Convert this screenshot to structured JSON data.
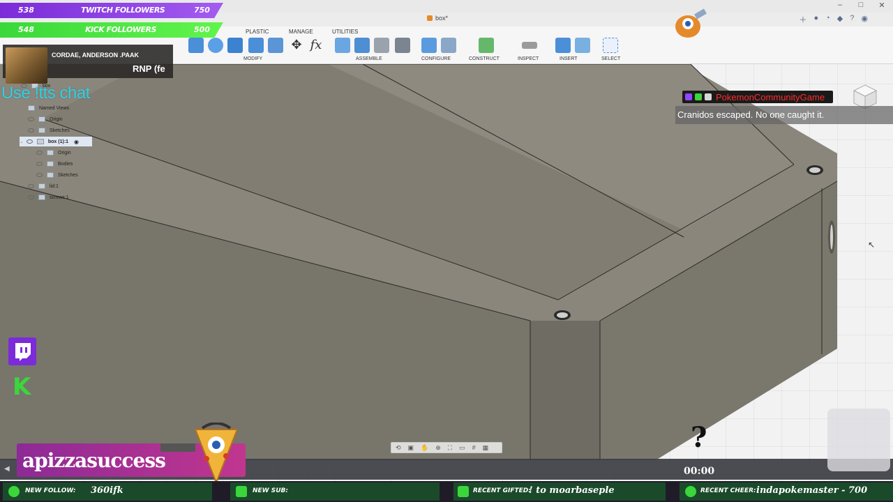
{
  "app": {
    "document_tab": "box*"
  },
  "toolbar": {
    "tabs": [
      "PLASTIC",
      "MANAGE",
      "UTILITIES"
    ],
    "groups": [
      "MODIFY",
      "ASSEMBLE",
      "CONFIGURE",
      "CONSTRUCT",
      "INSPECT",
      "INSERT",
      "SELECT"
    ]
  },
  "browser": {
    "items": [
      {
        "label": "box"
      },
      {
        "label": "Named Views"
      },
      {
        "label": "Origin"
      },
      {
        "label": "Sketches"
      },
      {
        "label": "box (1):1"
      },
      {
        "label": "Origin"
      },
      {
        "label": "Bodies"
      },
      {
        "label": "Sketches"
      },
      {
        "label": "lid:1"
      },
      {
        "label": "screws:1"
      }
    ]
  },
  "overlays": {
    "twitch_followers": {
      "current": "538",
      "label": "TWITCH FOLLOWERS",
      "goal": "750"
    },
    "kick_followers": {
      "current": "548",
      "label": "KICK FOLLOWERS",
      "goal": "500"
    },
    "now_playing": {
      "artist": "CORDAE, ANDERSON .PAAK",
      "track": "RNP (fe"
    },
    "chat_prompt": "Use !tts chat",
    "pcg": {
      "channel": "PokemonCommunityGame",
      "message": "Cranidos escaped. No one caught it."
    },
    "username": "apizzasuccess",
    "timer": "00:00",
    "ticker": [
      {
        "label": "NEW FOLLOW:",
        "value": "360ifk"
      },
      {
        "label": "NEW SUB:",
        "value": ""
      },
      {
        "label": "RECENT GIFTED:",
        "value": "! to moarbaseple"
      },
      {
        "label": "RECENT CHEER:",
        "value": "indapokemaster - 700"
      }
    ]
  },
  "colors": {
    "twitch_purple": "#7b2bd8",
    "kick_green": "#3ad83a",
    "chat_cyan": "#2fd0e6",
    "pcg_red": "#ff2b2b",
    "model_gray": "#858175"
  },
  "icons": [
    "search-icon",
    "eye-icon",
    "folder-icon",
    "gear-icon",
    "help-icon"
  ]
}
